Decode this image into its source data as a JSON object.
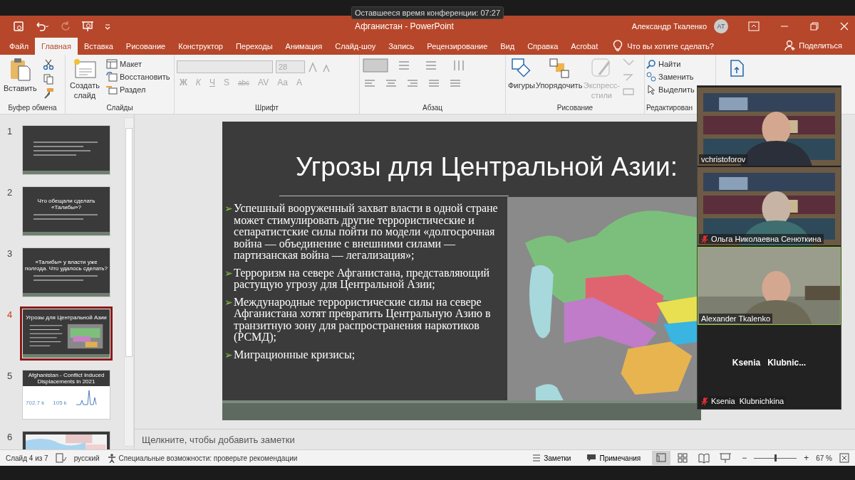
{
  "conference_timer": "Оставшееся время конференции: 07:27",
  "window": {
    "title": "Афганистан - PowerPoint",
    "user": "Александр Ткаленко",
    "avatar": "AT"
  },
  "tabs": [
    {
      "label": "Файл",
      "selected": false
    },
    {
      "label": "Главная",
      "selected": true
    },
    {
      "label": "Вставка",
      "selected": false
    },
    {
      "label": "Рисование",
      "selected": false
    },
    {
      "label": "Конструктор",
      "selected": false
    },
    {
      "label": "Переходы",
      "selected": false
    },
    {
      "label": "Анимация",
      "selected": false
    },
    {
      "label": "Слайд-шоу",
      "selected": false
    },
    {
      "label": "Запись",
      "selected": false
    },
    {
      "label": "Рецензирование",
      "selected": false
    },
    {
      "label": "Вид",
      "selected": false
    },
    {
      "label": "Справка",
      "selected": false
    },
    {
      "label": "Acrobat",
      "selected": false
    }
  ],
  "tell_me": "Что вы хотите сделать?",
  "share": "Поделиться",
  "clipboard": {
    "paste": "Вставить",
    "label": "Буфер обмена"
  },
  "slides_group": {
    "new_slide": "Создать слайд",
    "layout": "Макет",
    "reset": "Восстановить",
    "section": "Раздел",
    "label": "Слайды"
  },
  "font_group": {
    "size": "28",
    "label": "Шрифт",
    "format_buttons": [
      "Ж",
      "К",
      "Ч",
      "S",
      "abc",
      "AV",
      "Aa",
      "A"
    ]
  },
  "paragraph_group": {
    "label": "Абзац"
  },
  "drawing_group": {
    "shapes": "Фигуры",
    "arrange": "Упорядочить",
    "quick_styles": "Экспресс-стили",
    "label": "Рисование"
  },
  "editing_group": {
    "find": "Найти",
    "replace": "Заменить",
    "select": "Выделить",
    "label": "Редактирован"
  },
  "thumbnails": [
    {
      "number": "1",
      "selected": false,
      "kind": "text"
    },
    {
      "number": "2",
      "selected": false,
      "kind": "text",
      "title": "Что обещали сделать «Талибы»?"
    },
    {
      "number": "3",
      "selected": false,
      "kind": "text",
      "title": "«Талибы» у власти уже полгода. Что удалось сделать?"
    },
    {
      "number": "4",
      "selected": true,
      "kind": "map",
      "title": "Угрозы для Центральной Азии"
    },
    {
      "number": "5",
      "selected": false,
      "kind": "chart",
      "title": "Afghanistan - Conflict Induced Displacements in 2021",
      "figures": [
        "702.7 k",
        "105 k"
      ]
    },
    {
      "number": "6",
      "selected": false,
      "kind": "picture"
    }
  ],
  "slide": {
    "title": "Угрозы для Центральной Азии:",
    "bullet_mark": "➢",
    "bullets": [
      "Успешный вооруженный захват власти в одной стране может стимулировать другие террористические и сепаратистские силы пойти по модели «долгосрочная война — объединение с внешними силами — партизанская война  — легализация»;",
      "Терроризм на севере Афганистана, представляющий растущую угрозу для Центральной Азии;",
      "Международные террористические силы на севере Афганистана хотят превратить Центральную Азию в транзитную зону для распространения наркотиков (РСМД);",
      "Миграционные кризисы;"
    ]
  },
  "notes_placeholder": "Щелкните, чтобы добавить заметки",
  "status_bar": {
    "slide": "Слайд 4 из 7",
    "language": "русский",
    "accessibility": "Специальные возможности: проверьте рекомендации",
    "notes": "Заметки",
    "comments": "Примечания",
    "zoom": "67 %",
    "zoom_out": "−",
    "zoom_in": "+",
    "zoom_slider": {
      "level": 0.5
    }
  },
  "participants": [
    {
      "name": "vchristoforov",
      "muted": false,
      "video": true,
      "active": false
    },
    {
      "name": "Ольга Николаевна Сенюткина",
      "muted": true,
      "video": true,
      "active": false
    },
    {
      "name": "Alexander Tkalenko",
      "muted": false,
      "video": true,
      "active": true
    },
    {
      "name": "Ksenia  Klubnichkina",
      "display_name": "Ksenia   Klubnic...",
      "muted": true,
      "video": false,
      "active": false
    }
  ]
}
